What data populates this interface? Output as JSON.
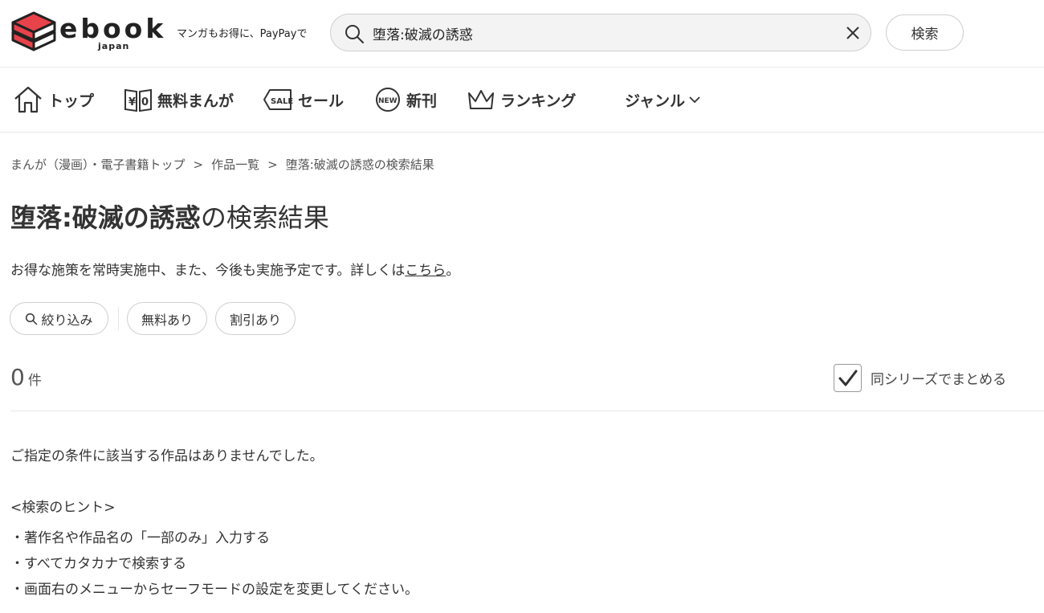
{
  "header": {
    "logo_text": "ebook",
    "logo_sub": "japan",
    "tagline": "マンガもお得に、PayPayで",
    "search_value": "堕落:破滅の誘惑",
    "search_button": "検索",
    "logo_color": "#e8424a"
  },
  "nav": {
    "items": [
      {
        "label": "トップ",
        "icon": "home-icon"
      },
      {
        "label": "無料まんが",
        "icon": "free-book-icon"
      },
      {
        "label": "セール",
        "icon": "sale-tag-icon"
      },
      {
        "label": "新刊",
        "icon": "new-badge-icon"
      },
      {
        "label": "ランキング",
        "icon": "crown-icon"
      },
      {
        "label": "ジャンル",
        "icon": "chevron-down-icon"
      }
    ]
  },
  "breadcrumb": {
    "items": [
      "まんが（漫画）・電子書籍トップ",
      "作品一覧",
      "堕落:破滅の誘惑の検索結果"
    ],
    "separator": ">"
  },
  "main": {
    "title_query": "堕落:破滅の誘惑",
    "title_suffix": "の検索結果",
    "notice_prefix": "お得な施策を常時実施中、また、今後も実施予定です。詳しくは",
    "notice_link": "こちら",
    "notice_suffix": "。",
    "filters": [
      "絞り込み",
      "無料あり",
      "割引あり"
    ],
    "count": "0",
    "count_unit": "件",
    "series_label": "同シリーズでまとめる",
    "series_checked": true,
    "no_result": "ご指定の条件に該当する作品はありませんでした。",
    "hint_title": "<検索のヒント>",
    "hints": [
      "・著作名や作品名の「一部のみ」入力する",
      "・すべてカタカナで検索する",
      "・画面右のメニューからセーフモードの設定を変更してください。"
    ]
  }
}
